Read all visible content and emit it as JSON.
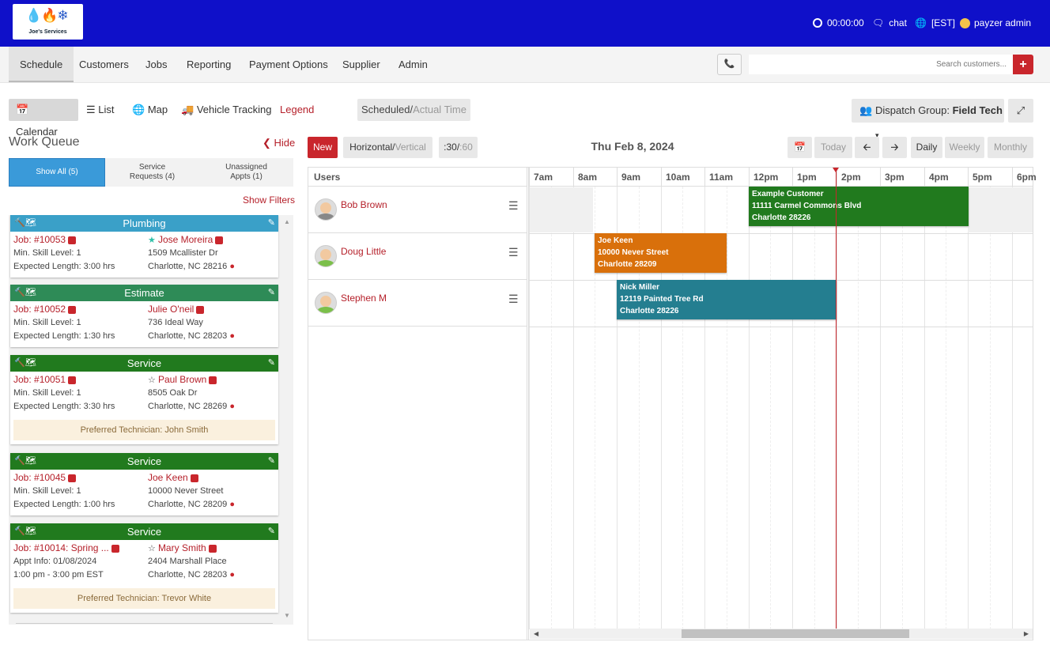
{
  "topbar": {
    "logo_text": "Joe's Services",
    "timer": "00:00:00",
    "chat": "chat",
    "timezone": "[EST]",
    "user": "payzer admin",
    "bg_color": "#0f10c9"
  },
  "nav": {
    "items": [
      "Schedule",
      "Customers",
      "Jobs",
      "Reporting",
      "Payment Options",
      "Supplier",
      "Admin"
    ],
    "search_placeholder": "Search customers...",
    "plus_label": "+"
  },
  "views": {
    "items": [
      "Calendar",
      "List",
      "Map",
      "Vehicle Tracking"
    ],
    "legend": "Legend",
    "scheduled": "Scheduled/",
    "actual": "Actual Time",
    "dispatch_label": "Dispatch Group:",
    "dispatch_value": "Field Tech"
  },
  "work_queue": {
    "title": "Work Queue",
    "hide": "Hide",
    "tabs": [
      {
        "line1": "Show All (5)",
        "line2": ""
      },
      {
        "line1": "Service",
        "line2": "Requests (4)"
      },
      {
        "line1": "Unassigned",
        "line2": "Appts (1)"
      }
    ],
    "show_filters": "Show Filters",
    "cards": [
      {
        "type": "Plumbing",
        "color": "#3aa0c8",
        "job": "Job: #10053",
        "customer": "Jose Moreira",
        "star": "filled",
        "line2a": "Min. Skill Level: 1",
        "line2b": "1509 Mcallister Dr",
        "line3a": "Expected Length: 3:00 hrs",
        "line3b": "Charlotte, NC 28216",
        "preferred": ""
      },
      {
        "type": "Estimate",
        "color": "#2e8b57",
        "job": "Job: #10052",
        "customer": "Julie O'neil",
        "star": "none",
        "line2a": "Min. Skill Level: 1",
        "line2b": "736 Ideal Way",
        "line3a": "Expected Length: 1:30 hrs",
        "line3b": "Charlotte, NC 28203",
        "preferred": ""
      },
      {
        "type": "Service",
        "color": "#217a1e",
        "job": "Job: #10051",
        "customer": "Paul Brown",
        "star": "outline",
        "line2a": "Min. Skill Level: 1",
        "line2b": "8505 Oak Dr",
        "line3a": "Expected Length: 3:30 hrs",
        "line3b": "Charlotte, NC 28269",
        "preferred": "Preferred Technician: John Smith"
      },
      {
        "type": "Service",
        "color": "#217a1e",
        "job": "Job: #10045",
        "customer": "Joe Keen",
        "star": "none",
        "line2a": "Min. Skill Level: 1",
        "line2b": "10000 Never Street",
        "line3a": "Expected Length: 1:00 hrs",
        "line3b": "Charlotte, NC 28209",
        "preferred": ""
      },
      {
        "type": "Service",
        "color": "#217a1e",
        "job": "Job: #10014: Spring ...",
        "customer": "Mary Smith",
        "star": "outline",
        "line2a": "Appt Info: 01/08/2024",
        "line2b": "2404 Marshall Place",
        "line3a": "1:00 pm - 3:00 pm EST",
        "line3b": "Charlotte, NC 28203",
        "preferred": "Preferred Technician: Trevor White"
      }
    ]
  },
  "calendar": {
    "new": "New",
    "horizontal": "Horizontal/",
    "vertical": "Vertical",
    "min30": ":30/",
    "min60": ":60",
    "date": "Thu Feb 8, 2024",
    "today": "Today",
    "daily": "Daily",
    "weekly": "Weekly",
    "monthly": "Monthly",
    "users_header": "Users",
    "hours": [
      "7am",
      "8am",
      "9am",
      "10am",
      "11am",
      "12pm",
      "1pm",
      "2pm",
      "3pm",
      "4pm",
      "5pm",
      "6pm"
    ],
    "users": [
      "Bob Brown",
      "Doug Little",
      "Stephen M"
    ],
    "appointments": [
      {
        "user": "Bob Brown",
        "name": "Example Customer",
        "street": "11111 Carmel Commons Blvd",
        "city": "Charlotte 28226",
        "color": "#217a1e",
        "start": "12:00",
        "end": "17:00"
      },
      {
        "user": "Doug Little",
        "name": "Joe Keen",
        "street": "10000 Never Street",
        "city": "Charlotte 28209",
        "color": "#d9700b",
        "start": "8:30",
        "end": "11:30"
      },
      {
        "user": "Stephen M",
        "name": "Nick Miller",
        "street": "12119 Painted Tree Rd",
        "city": "Charlotte 28226",
        "color": "#247e90",
        "start": "9:00",
        "end": "14:00"
      }
    ]
  }
}
